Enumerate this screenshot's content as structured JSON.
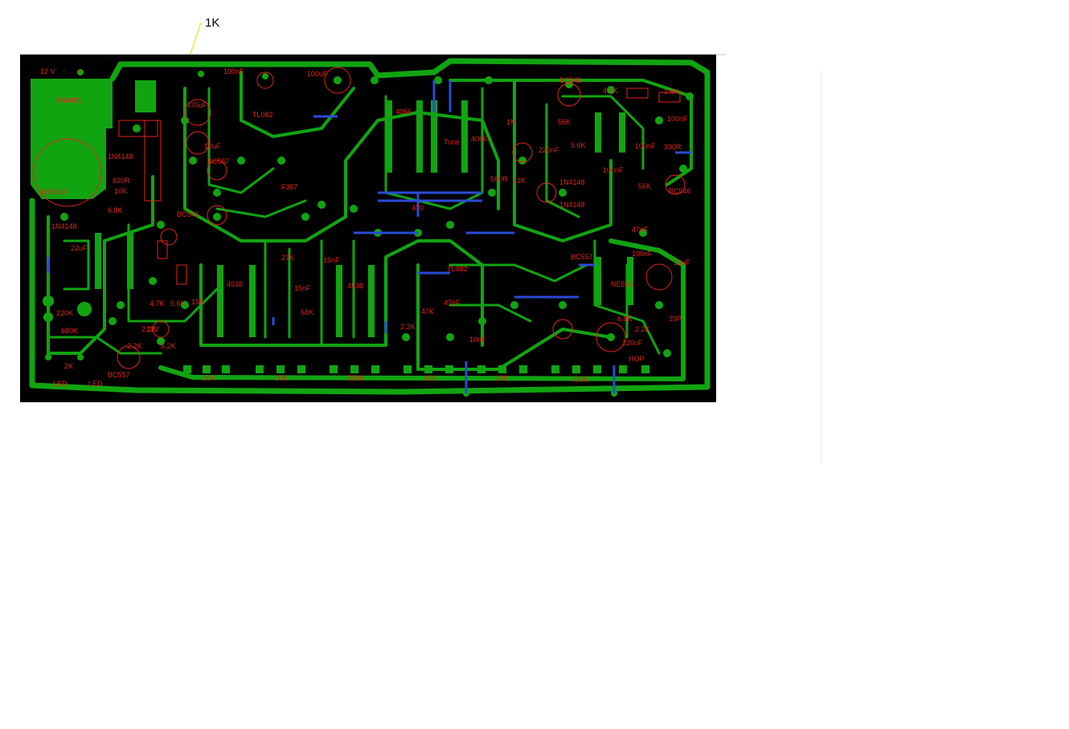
{
  "callout": {
    "text": "1K"
  },
  "board": {
    "background": "#000000",
    "copper_color": "#11a411",
    "via_color": "#2a4bd7",
    "silk_color": "#e4231c"
  },
  "labels": [
    "12 V",
    "-",
    "+",
    "1N4001",
    "10000uF",
    "1N4148",
    "820R",
    "10K",
    "470uF",
    "10uF",
    "100nF",
    "100uF",
    "TL082",
    "4066",
    "4066",
    "Tune",
    "BC546",
    "BC546",
    "BC546",
    "BC557",
    "BC557",
    "BC557",
    "F357",
    "470",
    "4.7K",
    "56K",
    "5.6K",
    "1M",
    "220nF",
    "22K",
    "560R",
    "1N4148",
    "1N4148",
    "6.8K",
    "1.6K",
    "100nF",
    "100nF",
    "100nF",
    "330R",
    "56K",
    "47nF",
    "100nF",
    "10uF",
    "NE555",
    "220uF",
    "2.2K",
    "39P",
    "HOP",
    "6.8K",
    "1N4148",
    "22uF",
    "220K",
    "680K",
    "2K",
    "LED",
    "LED",
    "4.7K",
    "5.6K",
    "15K",
    "2.2K",
    "4538",
    "4538",
    "15nF",
    "15nF",
    "27K",
    "68K",
    "2.2K",
    "47K",
    "47nF",
    "10nF",
    "TL082",
    "20K",
    "50K",
    "500K",
    "10K",
    "10K",
    "470R",
    "8.2K",
    "2.2K",
    "12V"
  ]
}
